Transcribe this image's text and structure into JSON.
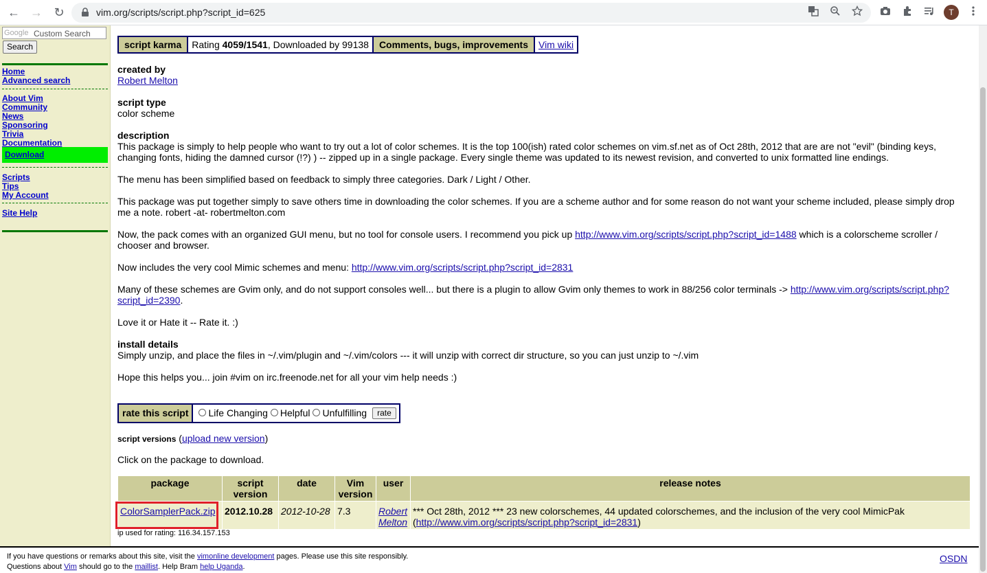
{
  "browser": {
    "url_text": "vim.org/scripts/script.php?script_id=625",
    "profile_initial": "T",
    "nav": {
      "back": "←",
      "forward": "→",
      "reload": "↻"
    },
    "icons": [
      "translate-icon",
      "zoom-icon",
      "star-icon",
      "camera-icon",
      "extensions-icon",
      "media-icon",
      "menu-icon"
    ]
  },
  "sidebar": {
    "search_brand": "Google",
    "search_placeholder": "Custom Search",
    "search_button": "Search",
    "links_group1": [
      "Home",
      "Advanced search"
    ],
    "links_group2": [
      "About Vim",
      "Community",
      "News",
      "Sponsoring",
      "Trivia",
      "Documentation"
    ],
    "download": "Download",
    "links_group3": [
      "Scripts",
      "Tips",
      "My Account"
    ],
    "site_help": "Site Help"
  },
  "header": {
    "karma_label": "script karma",
    "rating_prefix": "Rating ",
    "rating_value": "4059/1541",
    "downloads_text": ", Downloaded by 99138",
    "comments_label": "Comments, bugs, improvements",
    "wiki_link": "Vim wiki"
  },
  "created_by": {
    "title": "created by",
    "author": "Robert Melton"
  },
  "script_type": {
    "title": "script type",
    "value": "color scheme"
  },
  "description": {
    "title": "description",
    "p1": "This package is simply to help people who want to try out a lot of color schemes.  It is the top 100(ish) rated color schemes on vim.sf.net as of Oct 28th, 2012 that are are not \"evil\" (binding keys, changing fonts, hiding the damned cursor (!?) ) --  zipped up in a single package.  Every single theme was updated to its newest revision, and converted to unix formatted line endings.",
    "p2": "The menu has been simplified based on feedback to simply three categories.  Dark / Light / Other.",
    "p3": "This package was put together simply to save others time in downloading the color schemes.  If you are a scheme author and for some reason do not want your scheme included, please simply drop me a note.  robert -at- robertmelton.com",
    "p4_pre": "Now, the pack comes with an organized GUI menu, but no tool for console users.  I recommend you pick up ",
    "p4_link": "http://www.vim.org/scripts/script.php?script_id=1488",
    "p4_post": " which is a colorscheme scroller / chooser and browser.",
    "p5_pre": "Now includes the very cool Mimic schemes and menu: ",
    "p5_link": "http://www.vim.org/scripts/script.php?script_id=2831",
    "p6_pre": "Many of these schemes are Gvim only, and do not support consoles well... but there is a plugin to allow Gvim only themes to work in 88/256 color terminals -> ",
    "p6_link": "http://www.vim.org/scripts/script.php?script_id=2390",
    "p6_post": ".",
    "p7": "Love it or Hate it -- Rate it.  :)"
  },
  "install": {
    "title": "install details",
    "p1": "Simply unzip, and place the files in ~/.vim/plugin and ~/.vim/colors --- it will unzip with correct dir structure, so you can just unzip to ~/.vim",
    "p2": "Hope this helps you... join #vim on irc.freenode.net for all your vim help needs :)"
  },
  "rating": {
    "label": "rate this script",
    "options": [
      "Life Changing",
      "Helpful",
      "Unfulfilling"
    ],
    "button": "rate"
  },
  "versions": {
    "label": "script versions",
    "open_paren": " (",
    "upload_link": "upload new version",
    "close_paren": ")",
    "click_text": "Click on the package to download."
  },
  "package_table": {
    "headers": [
      "package",
      "script version",
      "date",
      "Vim version",
      "user",
      "release notes"
    ],
    "row": {
      "package": "ColorSamplerPack.zip",
      "script_version": "2012.10.28",
      "date": "2012-10-28",
      "vim_version": "7.3",
      "user": "Robert Melton",
      "notes_pre": "*** Oct 28th, 2012 *** 23 new colorschemes, 44 updated colorschemes, and the inclusion of the very cool MimicPak (",
      "notes_link": "http://www.vim.org/scripts/script.php?script_id=2831",
      "notes_post": ")"
    }
  },
  "ip_line": "ip used for rating: 116.34.157.153",
  "footer": {
    "line1_pre": "If you have questions or remarks about this site, visit the ",
    "line1_link": "vimonline development",
    "line1_post": " pages. Please use this site responsibly.",
    "line2_pre": "Questions about ",
    "line2_link1": "Vim",
    "line2_mid1": " should go to the ",
    "line2_link2": "maillist",
    "line2_mid2": ". Help Bram ",
    "line2_link3": "help Uganda",
    "line2_post": ".",
    "osdn": "OSDN"
  }
}
